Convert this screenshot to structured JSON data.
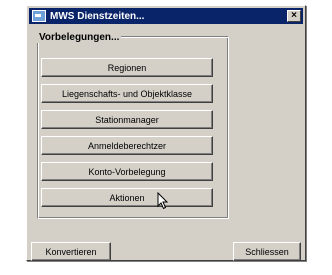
{
  "window": {
    "title": "MWS Dienstzeiten...",
    "close_glyph": "×",
    "title_icon": "app-window-icon",
    "title_bar_color": "#0a246a"
  },
  "group": {
    "label": "Vorbelegungen...",
    "buttons": [
      {
        "label": "Regionen"
      },
      {
        "label": "Liegenschafts- und Objektklasse"
      },
      {
        "label": "Stationmanager"
      },
      {
        "label": "Anmeldeberechtzer"
      },
      {
        "label": "Konto-Vorbelegung"
      },
      {
        "label": "Aktionen"
      }
    ]
  },
  "footer": {
    "left_button": "Konvertieren",
    "right_button": "Schliessen"
  },
  "cursor": {
    "icon": "mouse-pointer-icon"
  }
}
